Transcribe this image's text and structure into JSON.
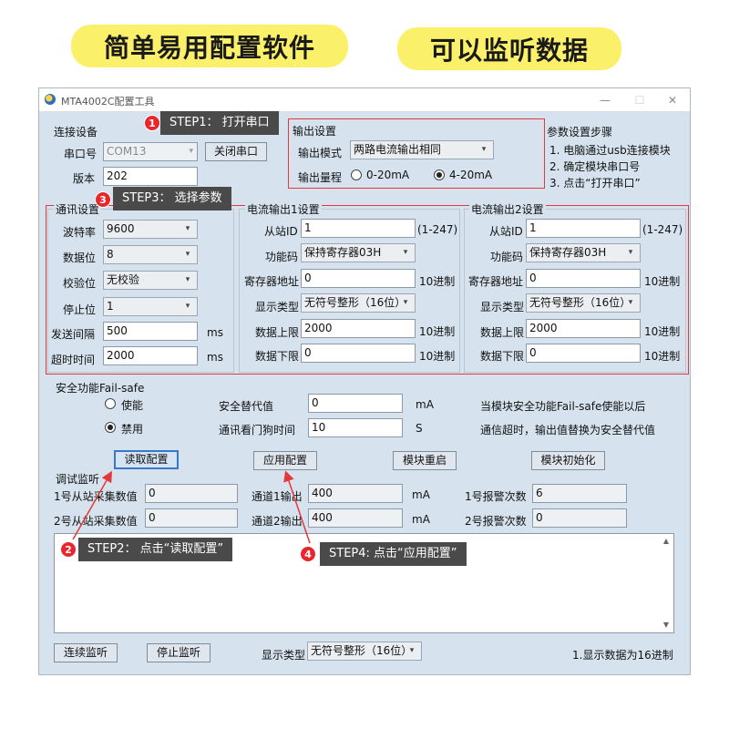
{
  "banners": {
    "left": "简单易用配置软件",
    "right": "可以监听数据"
  },
  "window": {
    "title": "MTA4002C配置工具"
  },
  "connect": {
    "title": "连接设备",
    "port_label": "串口号",
    "port_value": "COM13",
    "close_button": "关闭串口",
    "version_label": "版本",
    "version_value": "202"
  },
  "output": {
    "title": "输出设置",
    "mode_label": "输出模式",
    "mode_value": "两路电流输出相同",
    "range_label": "输出量程",
    "range_options": [
      "0-20mA",
      "4-20mA"
    ],
    "range_selected": "4-20mA"
  },
  "steps": {
    "title": "参数设置步骤",
    "items": [
      "1. 电脑通过usb连接模块",
      "2. 确定模块串口号",
      "3. 点击“打开串口”"
    ]
  },
  "comm": {
    "title": "通讯设置",
    "baud_label": "波特率",
    "baud_value": "9600",
    "databits_label": "数据位",
    "databits_value": "8",
    "parity_label": "校验位",
    "parity_value": "无校验",
    "stopbits_label": "停止位",
    "stopbits_value": "1",
    "interval_label": "发送间隔",
    "interval_value": "500",
    "interval_unit": "ms",
    "timeout_label": "超时时间",
    "timeout_value": "2000",
    "timeout_unit": "ms"
  },
  "ch1": {
    "title": "电流输出1设置",
    "slave_label": "从站ID",
    "slave_value": "1",
    "slave_hint": "(1-247)",
    "func_label": "功能码",
    "func_value": "保持寄存器03H",
    "reg_label": "寄存器地址",
    "reg_value": "0",
    "reg_unit": "10进制",
    "type_label": "显示类型",
    "type_value": "无符号整形（16位）",
    "upper_label": "数据上限",
    "upper_value": "2000",
    "upper_unit": "10进制",
    "lower_label": "数据下限",
    "lower_value": "0",
    "lower_unit": "10进制"
  },
  "ch2": {
    "title": "电流输出2设置",
    "slave_label": "从站ID",
    "slave_value": "1",
    "slave_hint": "(1-247)",
    "func_label": "功能码",
    "func_value": "保持寄存器03H",
    "reg_label": "寄存器地址",
    "reg_value": "0",
    "reg_unit": "10进制",
    "type_label": "显示类型",
    "type_value": "无符号整形（16位）",
    "upper_label": "数据上限",
    "upper_value": "2000",
    "upper_unit": "10进制",
    "lower_label": "数据下限",
    "lower_value": "0",
    "lower_unit": "10进制"
  },
  "failsafe": {
    "title": "安全功能Fail-safe",
    "enable_label": "使能",
    "disable_label": "禁用",
    "selected": "禁用",
    "safe_label": "安全替代值",
    "safe_value": "0",
    "safe_unit": "mA",
    "safe_note": "当模块安全功能Fail-safe使能以后",
    "watchdog_label": "通讯看门狗时间",
    "watchdog_value": "10",
    "watchdog_unit": "S",
    "watchdog_note": "通信超时，输出值替换为安全替代值"
  },
  "actions": {
    "read": "读取配置",
    "apply": "应用配置",
    "reboot": "模块重启",
    "init": "模块初始化"
  },
  "monitor": {
    "title": "调试监听",
    "s1_label": "1号从站采集数值",
    "s1_value": "0",
    "s2_label": "2号从站采集数值",
    "s2_value": "0",
    "c1_label": "通道1输出",
    "c1_value": "400",
    "c1_unit": "mA",
    "c2_label": "通道2输出",
    "c2_value": "400",
    "c2_unit": "mA",
    "a1_label": "1号报警次数",
    "a1_value": "6",
    "a2_label": "2号报警次数",
    "a2_value": "0"
  },
  "bottom": {
    "continuous": "连续监听",
    "stop": "停止监听",
    "type_label": "显示类型",
    "type_value": "无符号整形（16位）",
    "note": "1.显示数据为16进制"
  },
  "callouts": {
    "step1": "STEP1：  打开串口",
    "step2": "STEP2：  点击“读取配置”",
    "step3": "STEP3：  选择参数",
    "step4": "STEP4: 点击“应用配置”",
    "n1": "1",
    "n2": "2",
    "n3": "3",
    "n4": "4"
  },
  "colors": {
    "banner": "#fbf06a",
    "window_bg": "#d6e3ee",
    "highlight_red": "#e23a3a",
    "callout_bg": "#4a4a4a"
  }
}
